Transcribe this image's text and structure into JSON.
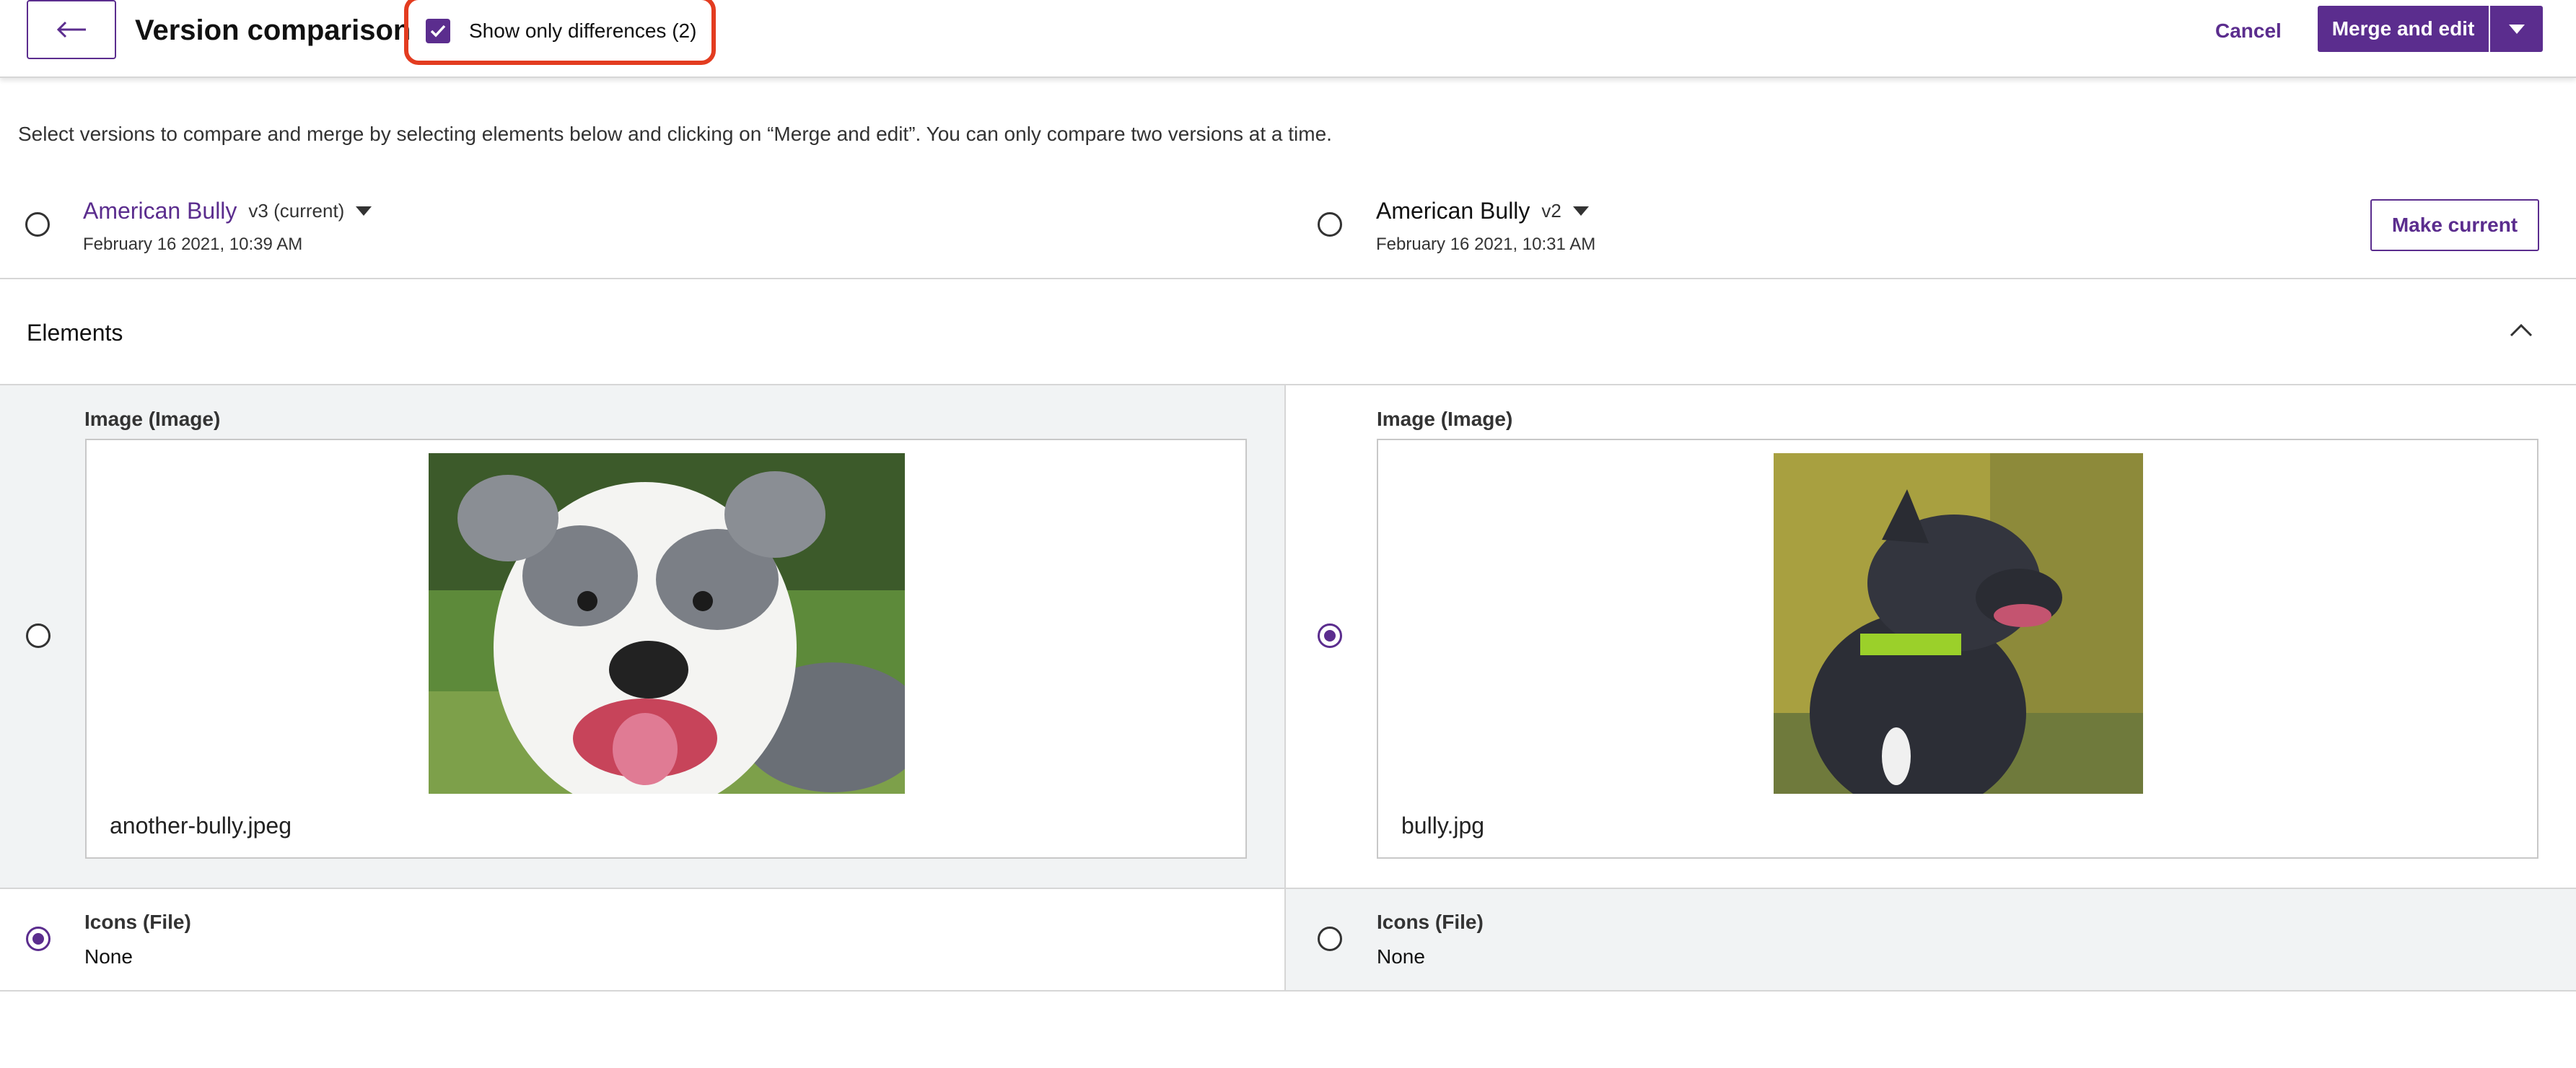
{
  "header": {
    "title": "Version comparison",
    "show_differences_label": "Show only differences (2)",
    "show_differences_checked": true,
    "cancel_label": "Cancel",
    "merge_label": "Merge and edit",
    "highlight_color": "#e33c20"
  },
  "intro_text": "Select versions to compare and merge by selecting elements below and clicking on “Merge and edit”. You can only compare two versions at a time.",
  "versions": [
    {
      "name": "American Bully",
      "tag": "v3 (current)",
      "date": "February 16 2021, 10:39 AM",
      "selected": false
    },
    {
      "name": "American Bully",
      "tag": "v2",
      "date": "February 16 2021, 10:31 AM",
      "selected": false
    }
  ],
  "make_current_label": "Make current",
  "elements_title": "Elements",
  "fields": {
    "image": {
      "label": "Image (Image)",
      "left": {
        "filename": "another-bully.jpeg",
        "selected": false,
        "image_desc": "grey-and-white-bully-dog-photo"
      },
      "right": {
        "filename": "bully.jpg",
        "selected": true,
        "image_desc": "black-bully-dog-photo"
      }
    },
    "icons": {
      "label": "Icons (File)",
      "left": {
        "value": "None",
        "selected": true
      },
      "right": {
        "value": "None",
        "selected": false
      }
    }
  },
  "colors": {
    "accent": "#5b2d8e",
    "panel_grey": "#f1f3f4"
  }
}
